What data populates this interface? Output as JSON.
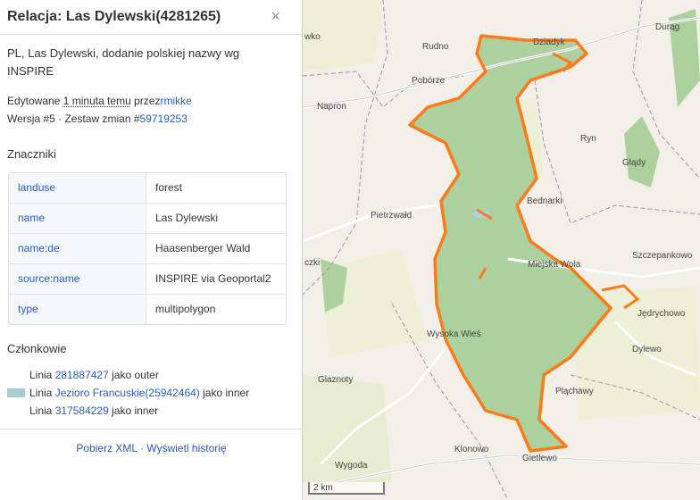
{
  "panel": {
    "title": "Relacja: Las Dylewski(4281265)",
    "close": "×",
    "description": "PL, Las Dylewski, dodanie polskiej nazwy wg INSPIRE",
    "edited_prefix": "Edytowane",
    "edited_time": "1 minuta temu",
    "edited_by_label": "przez",
    "editor": "rmikke",
    "version_text": "Wersja #5 · Zestaw zmian #",
    "changeset": "59719253",
    "tags_title": "Znaczniki",
    "tags": [
      {
        "key": "landuse",
        "value": "forest",
        "value_is_link": true
      },
      {
        "key": "name",
        "value": "Las Dylewski"
      },
      {
        "key": "name:de",
        "value": "Haasenberger Wald"
      },
      {
        "key": "source:name",
        "value": "INSPIRE via Geoportal2"
      },
      {
        "key": "type",
        "value": "multipolygon"
      }
    ],
    "members_title": "Członkowie",
    "members": [
      {
        "type": "Linia",
        "ref": "281887427",
        "role": "jako outer",
        "swatch": ""
      },
      {
        "type": "Linia",
        "ref": "Jezioro Francuskie(25942464)",
        "role": "jako inner",
        "swatch": "#aacbd0"
      },
      {
        "type": "Linia",
        "ref": "317584229",
        "role": "jako inner",
        "swatch": ""
      }
    ],
    "download_xml": "Pobierz XML",
    "separator": "·",
    "show_history": "Wyświetl historię"
  },
  "map": {
    "labels": [
      "Dziadyk",
      "Durąg",
      "Rudno",
      "Pobórze",
      "Napron",
      "Ryn",
      "Glądy",
      "Bednarki",
      "Pietrzwałd",
      "Szczepankowo",
      "Miejska Wola",
      "Jędrychowo",
      "Wysoka Wieś",
      "Dylewo",
      "Glaznoty",
      "Pląchawy",
      "Klonowo",
      "Gietlewo",
      "Wygoda",
      "wko",
      "czki"
    ],
    "scale": "2 km",
    "colors": {
      "forest": "#add19e",
      "boundary": "#ff7a1a",
      "admin": "#a08eb8",
      "road": "#ffffff",
      "base": "#f2efe9",
      "farmland": "#eef0d5"
    }
  }
}
